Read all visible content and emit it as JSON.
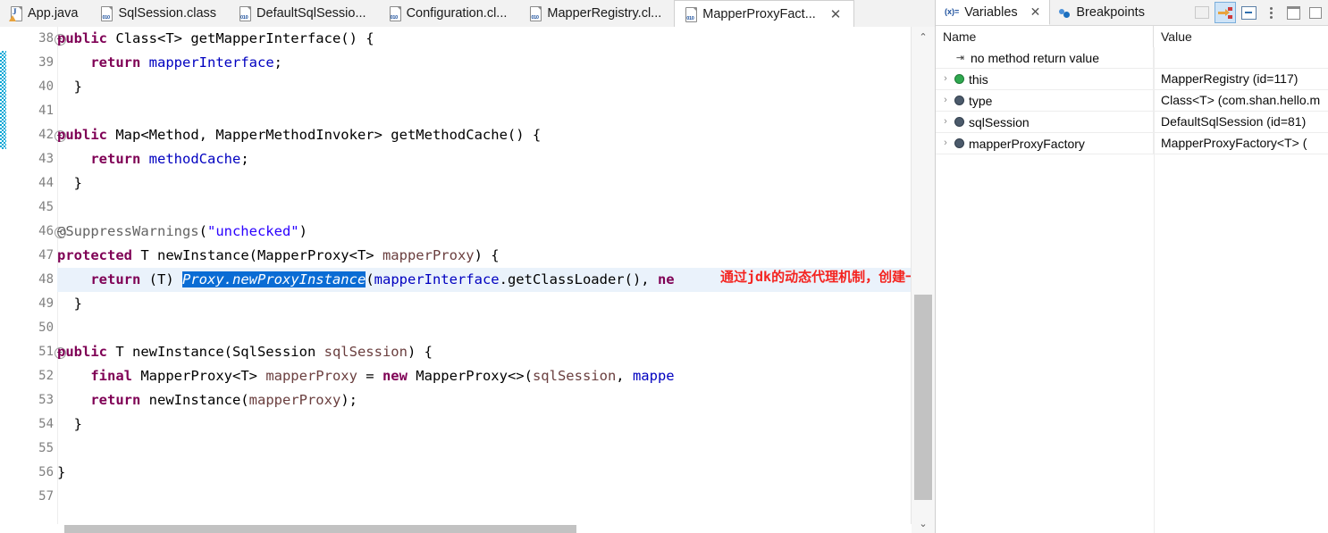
{
  "editor": {
    "tabs": [
      {
        "label": "App.java",
        "icon": "java-file-icon",
        "active": false,
        "closable": false
      },
      {
        "label": "SqlSession.class",
        "icon": "class-file-icon",
        "active": false,
        "closable": false
      },
      {
        "label": "DefaultSqlSessio...",
        "icon": "class-file-icon",
        "active": false,
        "closable": false
      },
      {
        "label": "Configuration.cl...",
        "icon": "class-file-icon",
        "active": false,
        "closable": false
      },
      {
        "label": "MapperRegistry.cl...",
        "icon": "class-file-icon",
        "active": false,
        "closable": false
      },
      {
        "label": "MapperProxyFact...",
        "icon": "class-file-icon",
        "active": true,
        "closable": true,
        "close_label": "✕"
      }
    ],
    "lines": [
      {
        "num": "38",
        "folding": true,
        "highlight": false
      },
      {
        "num": "39",
        "folding": false,
        "highlight": false
      },
      {
        "num": "40",
        "folding": false,
        "highlight": false
      },
      {
        "num": "41",
        "folding": false,
        "highlight": false
      },
      {
        "num": "42",
        "folding": true,
        "highlight": false
      },
      {
        "num": "43",
        "folding": false,
        "highlight": false
      },
      {
        "num": "44",
        "folding": false,
        "highlight": false
      },
      {
        "num": "45",
        "folding": false,
        "highlight": false
      },
      {
        "num": "46",
        "folding": true,
        "highlight": false
      },
      {
        "num": "47",
        "folding": false,
        "highlight": false
      },
      {
        "num": "48",
        "folding": false,
        "highlight": true
      },
      {
        "num": "49",
        "folding": false,
        "highlight": false
      },
      {
        "num": "50",
        "folding": false,
        "highlight": false
      },
      {
        "num": "51",
        "folding": true,
        "highlight": false
      },
      {
        "num": "52",
        "folding": false,
        "highlight": false
      },
      {
        "num": "53",
        "folding": false,
        "highlight": false
      },
      {
        "num": "54",
        "folding": false,
        "highlight": false
      },
      {
        "num": "55",
        "folding": false,
        "highlight": false
      },
      {
        "num": "56",
        "folding": false,
        "highlight": false
      },
      {
        "num": "57",
        "folding": false,
        "highlight": false
      }
    ],
    "code_text": {
      "l38": "  public Class<T> getMapperInterface() {",
      "l38_kw": "public",
      "l38_rest1": " Class<T> getMapperInterface() {",
      "l39_kw": "return",
      "l39_fld": "mapperInterface",
      "l40": "  }",
      "l41": "",
      "l42_kw": "public",
      "l42_rest": " Map<Method, MapperMethodInvoker> getMethodCache() {",
      "l43_kw": "return",
      "l43_fld": "methodCache",
      "l44": "  }",
      "l45": "",
      "l46_ann": "@SuppressWarnings",
      "l46_str": "\"unchecked\"",
      "l47_kw": "protected",
      "l47_rest": " T newInstance(MapperProxy<T> ",
      "l47_par": "mapperProxy",
      "l47_tail": ") {",
      "l48_kw": "return",
      "l48_cast": " (T) ",
      "l48_sel": "Proxy.newProxyInstance",
      "l48_fld": "mapperInterface",
      "l48_mid": ".getClassLoader(), ",
      "l48_kw2": "ne",
      "l49": "  }",
      "l50": "",
      "l51_kw": "public",
      "l51_rest": " T newInstance(SqlSession ",
      "l51_par": "sqlSession",
      "l51_tail": ") {",
      "l52_kw": "final",
      "l52_mid": " MapperProxy<T> ",
      "l52_par": "mapperProxy",
      "l52_eq": " = ",
      "l52_new": "new",
      "l52_rest": " MapperProxy<>(",
      "l52_par2": "sqlSession",
      "l52_comma": ", ",
      "l52_fld": "mappe",
      "l53_kw": "return",
      "l53_rest": " newInstance(",
      "l53_par": "mapperProxy",
      "l53_tail": ");",
      "l54": "  }",
      "l55": "",
      "l56": "}",
      "l57": ""
    },
    "annotation_note": "通过jdk的动态代理机制，创建一个mapper的代理对象",
    "annotation_color": "#f4231f",
    "scroll_up_glyph": "⌃",
    "scroll_down_glyph": "⌄",
    "selection_color": "#0a6cd4",
    "highlight_line_color": "#eaf2fb",
    "change_bar_color": "#00a6d6"
  },
  "variables": {
    "tabs": [
      {
        "label": "Variables",
        "icon": "variables-icon",
        "icon_text": "(x)=",
        "active": true,
        "close_label": "✕"
      },
      {
        "label": "Breakpoints",
        "icon": "breakpoints-icon",
        "active": false
      }
    ],
    "toolbar": [
      {
        "name": "show-logical-structure-button",
        "icon": "logical-structure-icon",
        "enabled": false
      },
      {
        "name": "collapse-expand-button",
        "icon": "step-into-selection-icon",
        "enabled": true,
        "selected": true
      },
      {
        "name": "collapse-all-button",
        "icon": "collapse-all-icon",
        "enabled": true
      },
      {
        "name": "view-menu-button",
        "icon": "view-menu-icon",
        "enabled": true
      },
      {
        "name": "minimize-button",
        "icon": "minimize-icon",
        "enabled": true
      },
      {
        "name": "maximize-button",
        "icon": "maximize-icon",
        "enabled": true
      }
    ],
    "columns": [
      "Name",
      "Value"
    ],
    "rows": [
      {
        "name": "no method return value",
        "value": "",
        "icon": "return-value-icon",
        "expandable": false,
        "indent": 1
      },
      {
        "name": "this",
        "value": "MapperRegistry  (id=117)",
        "icon": "this-object-icon",
        "expandable": true,
        "indent": 0
      },
      {
        "name": "type",
        "value": "Class<T> (com.shan.hello.m",
        "icon": "object-field-icon",
        "expandable": true,
        "indent": 0
      },
      {
        "name": "sqlSession",
        "value": "DefaultSqlSession  (id=81)",
        "icon": "object-field-icon",
        "expandable": true,
        "indent": 0
      },
      {
        "name": "mapperProxyFactory",
        "value": "MapperProxyFactory<T>  (",
        "icon": "object-field-icon",
        "expandable": true,
        "indent": 0
      }
    ],
    "expand_glyph": "›"
  }
}
